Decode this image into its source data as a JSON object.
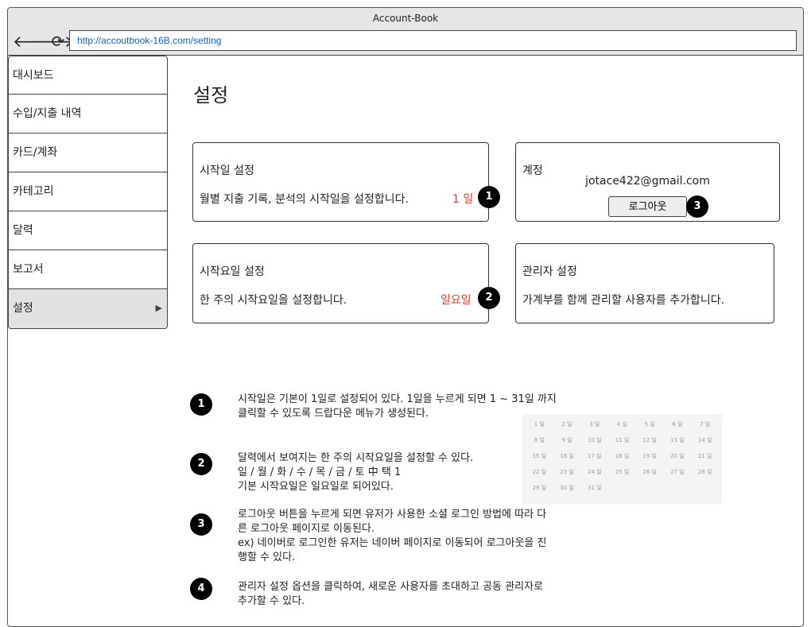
{
  "window": {
    "title": "Account-Book",
    "url": "http://accoutbook-16B.com/setting"
  },
  "nav": {
    "back_icon": "🡐",
    "forward_icon": "🡒",
    "reload_icon": "⟳"
  },
  "sidebar": {
    "items": [
      {
        "label": "대시보드"
      },
      {
        "label": "수입/지출 내역"
      },
      {
        "label": "카드/계좌"
      },
      {
        "label": "카테고리"
      },
      {
        "label": "달력"
      },
      {
        "label": "보고서"
      },
      {
        "label": "설정",
        "arrow": "▶"
      }
    ]
  },
  "page": {
    "title": "설정"
  },
  "cards": {
    "start_day": {
      "title": "시작일 설정",
      "desc": "월별 지출 기록, 분석의 시작일을 설정합니다.",
      "value": "1 일",
      "badge": "1"
    },
    "start_weekday": {
      "title": "시작요일 설정",
      "desc": "한 주의 시작요일을 설정합니다.",
      "value": "일요일",
      "badge": "2"
    },
    "account": {
      "title": "계정",
      "email": "jotace422@gmail.com",
      "logout_label": "로그아웃",
      "badge": "3"
    },
    "admin": {
      "title": "관리자 설정",
      "desc": "가계부를 함께 관리할 사용자를 추가합니다."
    }
  },
  "notes": [
    {
      "badge": "1",
      "text": "시작일은 기본이 1일로 설정되어 있다. 1일을 누르게 되면 1 ~ 31일 까지\n클릭할 수 있도록 드랍다운 메뉴가 생성된다."
    },
    {
      "badge": "2",
      "text": "달력에서 보여지는 한 주의 시작요일을 설정할 수 있다.\n일 / 월 / 화 / 수 / 목 / 금 / 토 中 택 1\n기본 시작요일은 일요일로 되어있다."
    },
    {
      "badge": "3",
      "text": "로그아웃 버튼을 누르게 되면 유저가 사용한 소셜 로그인 방법에 따라 다\n른 로그아웃 페이지로 이동된다.\nex) 네이버로 로그인한 유저는 네이버 페이지로 이동되어 로그아웃을 진\n행할 수 있다."
    },
    {
      "badge": "4",
      "text": "관리자 설정 옵션을 클릭하여, 새로운 사용자를 초대하고 공동 관리자로\n추가할 수 있다."
    }
  ],
  "calendar_days": [
    "1 일",
    "2 일",
    "3 일",
    "4 일",
    "5 일",
    "6 일",
    "7 일",
    "8 일",
    "9 일",
    "10 일",
    "11 일",
    "12 일",
    "13 일",
    "14 일",
    "15 일",
    "16 일",
    "17 일",
    "18 일",
    "19 일",
    "20 일",
    "21 일",
    "22 일",
    "23 일",
    "24 일",
    "25 일",
    "26 일",
    "27 일",
    "28 일",
    "29 일",
    "30 일",
    "31 일"
  ]
}
